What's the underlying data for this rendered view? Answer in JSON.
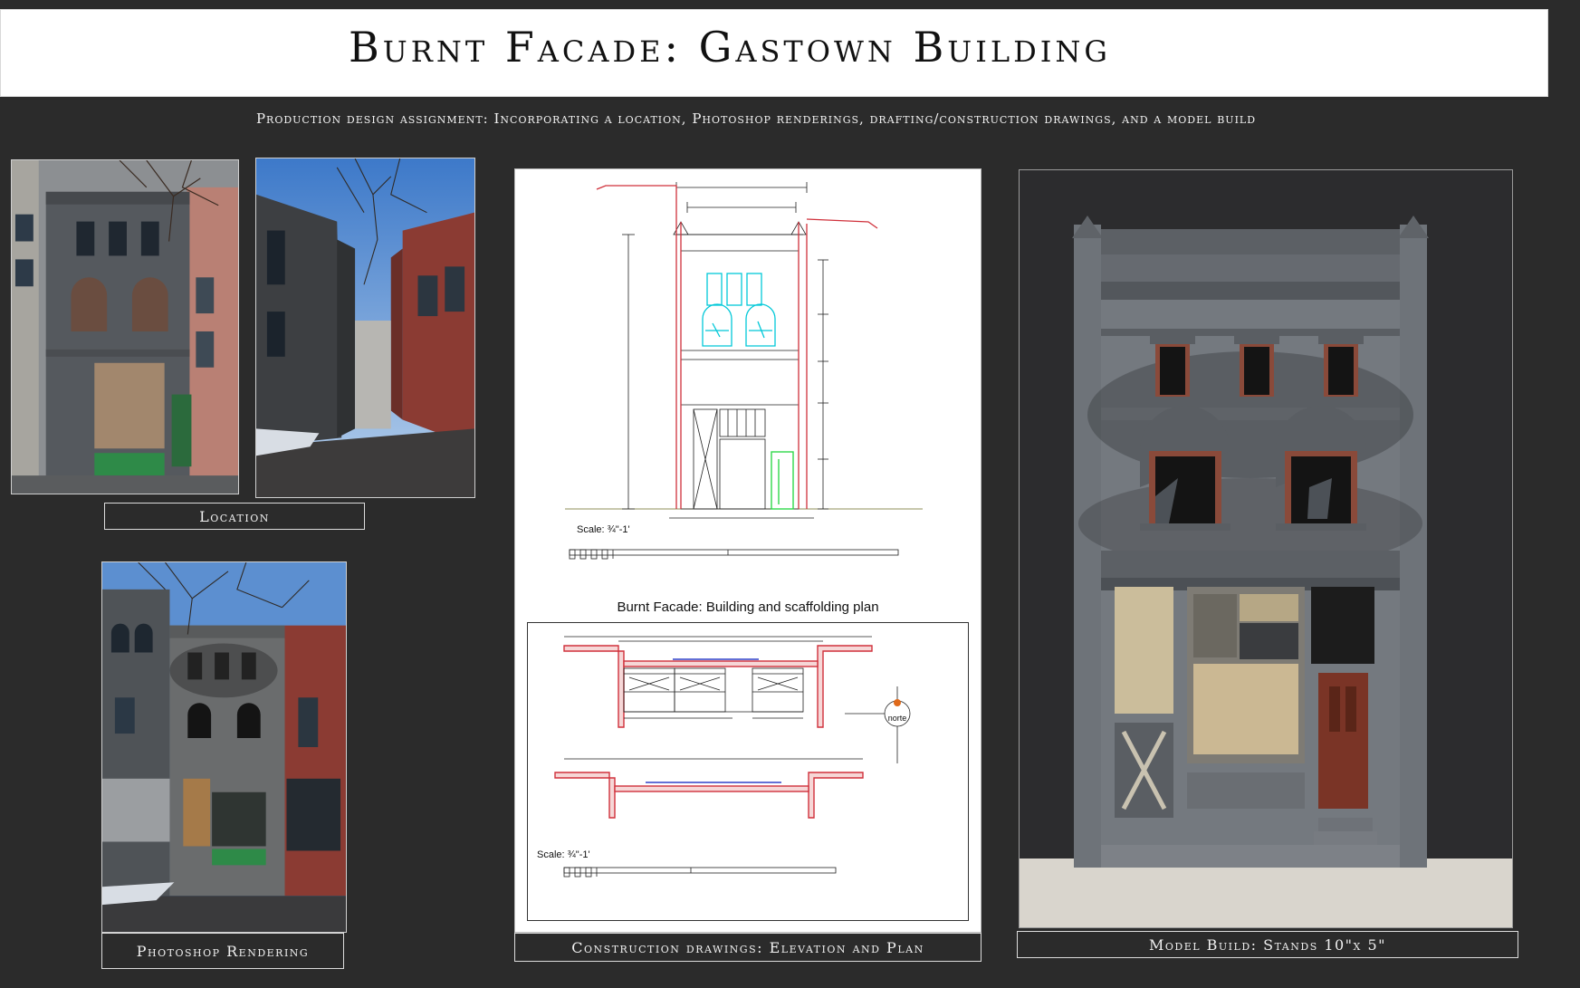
{
  "title": "Burnt Facade: Gastown Building",
  "subtitle": "Production design assignment: Incorporating a location, Photoshop renderings, drafting/construction drawings, and a model build",
  "captions": {
    "location": "Location",
    "rendering": "Photoshop Rendering",
    "drawings": "Construction drawings: Elevation and Plan",
    "model": "Model Build:  Stands 10\"x 5\""
  },
  "drawing_sheet": {
    "elevation_scale": "Scale: ¾\"-1'",
    "plan_title": "Burnt Facade:    Building and scaffolding plan",
    "plan_scale": "Scale: ¾\"-1'",
    "north_label": "norte"
  },
  "colors": {
    "background": "#2b2b2b",
    "banner": "#ffffff",
    "facade_gray": "#55595e",
    "brick_red": "#8a3a33",
    "door_green": "#2f8a4a",
    "cad_cyan": "#00c8d8",
    "cad_red": "#d0313b"
  }
}
